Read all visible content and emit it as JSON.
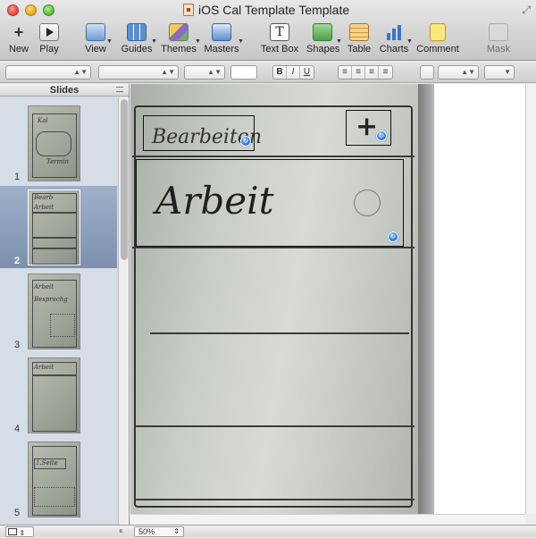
{
  "window": {
    "title": "iOS Cal Template Template"
  },
  "toolbar": {
    "items": [
      {
        "label": "New"
      },
      {
        "label": "Play"
      },
      {
        "label": "View"
      },
      {
        "label": "Guides"
      },
      {
        "label": "Themes"
      },
      {
        "label": "Masters"
      },
      {
        "label": "Text Box"
      },
      {
        "label": "Shapes"
      },
      {
        "label": "Table"
      },
      {
        "label": "Charts"
      },
      {
        "label": "Comment"
      },
      {
        "label": "Mask"
      }
    ]
  },
  "formatbar": {
    "bold": "B",
    "italic": "I",
    "underline": "U"
  },
  "slides_pane": {
    "header": "Slides",
    "slides": [
      {
        "number": "1",
        "selected": false
      },
      {
        "number": "2",
        "selected": true
      },
      {
        "number": "3",
        "selected": false
      },
      {
        "number": "4",
        "selected": false
      },
      {
        "number": "5",
        "selected": false
      }
    ]
  },
  "canvas": {
    "sketch_top_left": "Bearbeiten",
    "sketch_plus": "+",
    "sketch_main": "Arbeit"
  },
  "bottombar": {
    "zoom": "50%"
  }
}
